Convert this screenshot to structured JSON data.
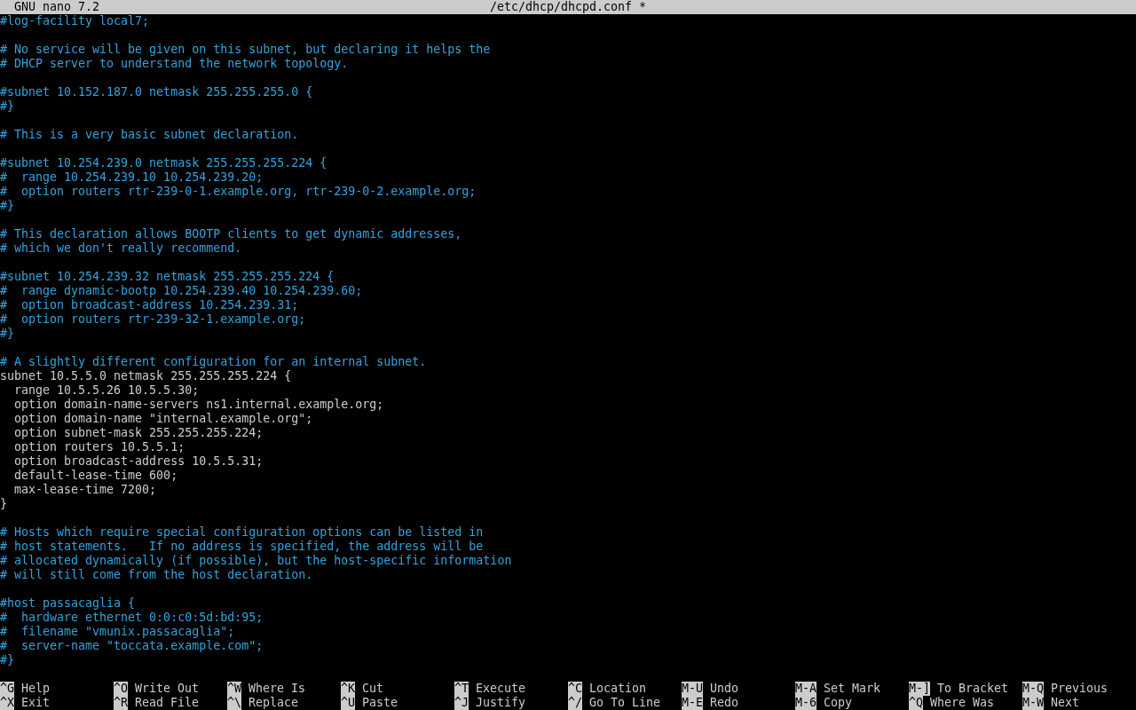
{
  "title_bar": {
    "app": "GNU nano 7.2",
    "file": "/etc/dhcp/dhcpd.conf *"
  },
  "lines": [
    {
      "kind": "comment",
      "text": "#log-facility local7;"
    },
    {
      "kind": "blank"
    },
    {
      "kind": "comment",
      "text": "# No service will be given on this subnet, but declaring it helps the"
    },
    {
      "kind": "comment",
      "text": "# DHCP server to understand the network topology."
    },
    {
      "kind": "blank"
    },
    {
      "kind": "comment",
      "text": "#subnet 10.152.187.0 netmask 255.255.255.0 {"
    },
    {
      "kind": "comment",
      "text": "#}"
    },
    {
      "kind": "blank"
    },
    {
      "kind": "comment",
      "text": "# This is a very basic subnet declaration."
    },
    {
      "kind": "blank"
    },
    {
      "kind": "comment",
      "text": "#subnet 10.254.239.0 netmask 255.255.255.224 {"
    },
    {
      "kind": "comment",
      "text": "#  range 10.254.239.10 10.254.239.20;"
    },
    {
      "kind": "comment",
      "text": "#  option routers rtr-239-0-1.example.org, rtr-239-0-2.example.org;"
    },
    {
      "kind": "comment",
      "text": "#}"
    },
    {
      "kind": "blank"
    },
    {
      "kind": "comment",
      "text": "# This declaration allows BOOTP clients to get dynamic addresses,"
    },
    {
      "kind": "comment",
      "text": "# which we don't really recommend."
    },
    {
      "kind": "blank"
    },
    {
      "kind": "comment",
      "text": "#subnet 10.254.239.32 netmask 255.255.255.224 {"
    },
    {
      "kind": "comment",
      "text": "#  range dynamic-bootp 10.254.239.40 10.254.239.60;"
    },
    {
      "kind": "comment",
      "text": "#  option broadcast-address 10.254.239.31;"
    },
    {
      "kind": "comment",
      "text": "#  option routers rtr-239-32-1.example.org;"
    },
    {
      "kind": "comment",
      "text": "#}"
    },
    {
      "kind": "blank"
    },
    {
      "kind": "comment",
      "text": "# A slightly different configuration for an internal subnet."
    },
    {
      "kind": "code",
      "text": "subnet 10.5.5.0 netmask 255.255.255.224 {"
    },
    {
      "kind": "code",
      "text": "  range 10.5.5.26 10.5.5.30;"
    },
    {
      "kind": "code",
      "text": "  option domain-name-servers ns1.internal.example.org;"
    },
    {
      "kind": "code",
      "text": "  option domain-name \"internal.example.org\";"
    },
    {
      "kind": "code",
      "text": "  option subnet-mask 255.255.255.224;"
    },
    {
      "kind": "code",
      "text": "  option routers 10.5.5.1;"
    },
    {
      "kind": "code",
      "text": "  option broadcast-address 10.5.5.31;"
    },
    {
      "kind": "code",
      "text": "  default-lease-time 600;"
    },
    {
      "kind": "code",
      "text": "  max-lease-time 7200;"
    },
    {
      "kind": "code",
      "text": "}"
    },
    {
      "kind": "blank"
    },
    {
      "kind": "comment",
      "text": "# Hosts which require special configuration options can be listed in"
    },
    {
      "kind": "comment",
      "text": "# host statements.   If no address is specified, the address will be"
    },
    {
      "kind": "comment",
      "text": "# allocated dynamically (if possible), but the host-specific information"
    },
    {
      "kind": "comment",
      "text": "# will still come from the host declaration."
    },
    {
      "kind": "blank"
    },
    {
      "kind": "comment",
      "text": "#host passacaglia {"
    },
    {
      "kind": "comment",
      "text": "#  hardware ethernet 0:0:c0:5d:bd:95;"
    },
    {
      "kind": "comment",
      "text": "#  filename \"vmunix.passacaglia\";"
    },
    {
      "kind": "comment",
      "text": "#  server-name \"toccata.example.com\";"
    },
    {
      "kind": "comment",
      "text": "#}"
    }
  ],
  "shortcuts": [
    {
      "key": "^G",
      "label": "Help"
    },
    {
      "key": "^O",
      "label": "Write Out"
    },
    {
      "key": "^W",
      "label": "Where Is"
    },
    {
      "key": "^K",
      "label": "Cut"
    },
    {
      "key": "^T",
      "label": "Execute"
    },
    {
      "key": "^C",
      "label": "Location"
    },
    {
      "key": "M-U",
      "label": "Undo"
    },
    {
      "key": "M-A",
      "label": "Set Mark"
    },
    {
      "key": "M-]",
      "label": "To Bracket"
    },
    {
      "key": "M-Q",
      "label": "Previous"
    },
    {
      "key": "^X",
      "label": "Exit"
    },
    {
      "key": "^R",
      "label": "Read File"
    },
    {
      "key": "^\\",
      "label": "Replace"
    },
    {
      "key": "^U",
      "label": "Paste"
    },
    {
      "key": "^J",
      "label": "Justify"
    },
    {
      "key": "^/",
      "label": "Go To Line"
    },
    {
      "key": "M-E",
      "label": "Redo"
    },
    {
      "key": "M-6",
      "label": "Copy"
    },
    {
      "key": "^Q",
      "label": "Where Was"
    },
    {
      "key": "M-W",
      "label": "Next"
    }
  ]
}
